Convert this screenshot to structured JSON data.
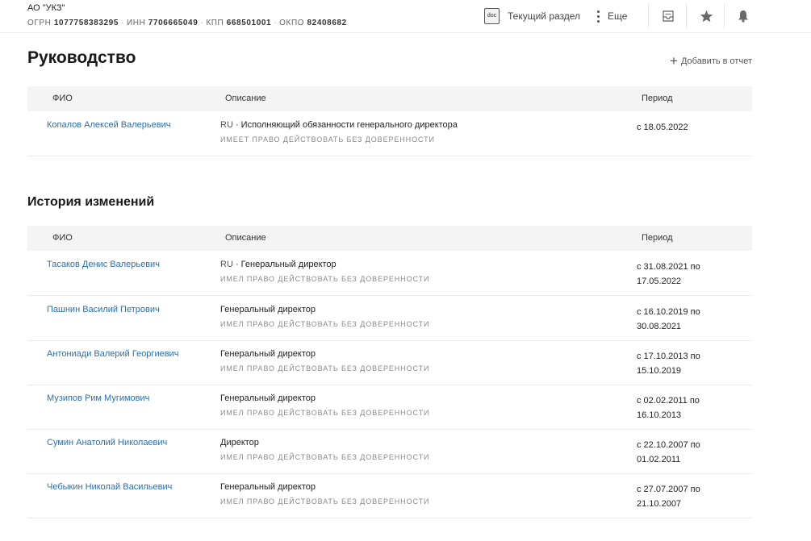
{
  "header": {
    "company_name": "АО \"УКЗ\"",
    "ogrn_label": "ОГРН",
    "ogrn": "1077758383295",
    "inn_label": "ИНН",
    "inn": "7706665049",
    "kpp_label": "КПП",
    "kpp": "668501001",
    "okpo_label": "ОКПО",
    "okpo": "82408682",
    "separator": "·",
    "current_section_label": "Текущий раздел",
    "current_section_icon_text": "doc",
    "more_label": "Еще"
  },
  "management": {
    "title": "Руководство",
    "add_to_report_label": "Добавить в отчет",
    "columns": {
      "fio": "ФИО",
      "description": "Описание",
      "period": "Период"
    },
    "rows": [
      {
        "fio": "Копалов Алексей Валерьевич",
        "country": "RU",
        "position": "Исполняющий обязанности генерального директора",
        "authority": "ИМЕЕТ ПРАВО ДЕЙСТВОВАТЬ БЕЗ ДОВЕРЕННОСТИ",
        "period": "с 18.05.2022"
      }
    ]
  },
  "history": {
    "title": "История изменений",
    "columns": {
      "fio": "ФИО",
      "description": "Описание",
      "period": "Период"
    },
    "rows": [
      {
        "fio": "Тасаков Денис Валерьевич",
        "country": "RU",
        "position": "Генеральный директор",
        "authority": "ИМЕЛ ПРАВО ДЕЙСТВОВАТЬ БЕЗ ДОВЕРЕННОСТИ",
        "period": "с 31.08.2021 по 17.05.2022"
      },
      {
        "fio": "Пашнин Василий Петрович",
        "country": "",
        "position": "Генеральный директор",
        "authority": "ИМЕЛ ПРАВО ДЕЙСТВОВАТЬ БЕЗ ДОВЕРЕННОСТИ",
        "period": "с 16.10.2019 по 30.08.2021"
      },
      {
        "fio": "Антониади Валерий Георгиевич",
        "country": "",
        "position": "Генеральный директор",
        "authority": "ИМЕЛ ПРАВО ДЕЙСТВОВАТЬ БЕЗ ДОВЕРЕННОСТИ",
        "period": "с 17.10.2013 по 15.10.2019"
      },
      {
        "fio": "Музипов Рим Мугимович",
        "country": "",
        "position": "Генеральный директор",
        "authority": "ИМЕЛ ПРАВО ДЕЙСТВОВАТЬ БЕЗ ДОВЕРЕННОСТИ",
        "period": "с 02.02.2011 по 16.10.2013"
      },
      {
        "fio": "Сумин Анатолий Николаевич",
        "country": "",
        "position": "Директор",
        "authority": "ИМЕЛ ПРАВО ДЕЙСТВОВАТЬ БЕЗ ДОВЕРЕННОСТИ",
        "period": "с 22.10.2007 по 01.02.2011"
      },
      {
        "fio": "Чебыкин Николай Васильевич",
        "country": "",
        "position": "Генеральный директор",
        "authority": "ИМЕЛ ПРАВО ДЕЙСТВОВАТЬ БЕЗ ДОВЕРЕННОСТИ",
        "period": "с 27.07.2007 по 21.10.2007"
      }
    ]
  },
  "colors": {
    "link": "#2a6fb0",
    "table_header_bg": "#f4f4f4",
    "muted_text": "#8a8a8a"
  },
  "icons": [
    "doc-icon",
    "more-vertical-icon",
    "inbox-icon",
    "star-icon",
    "bell-icon",
    "plus-icon"
  ]
}
